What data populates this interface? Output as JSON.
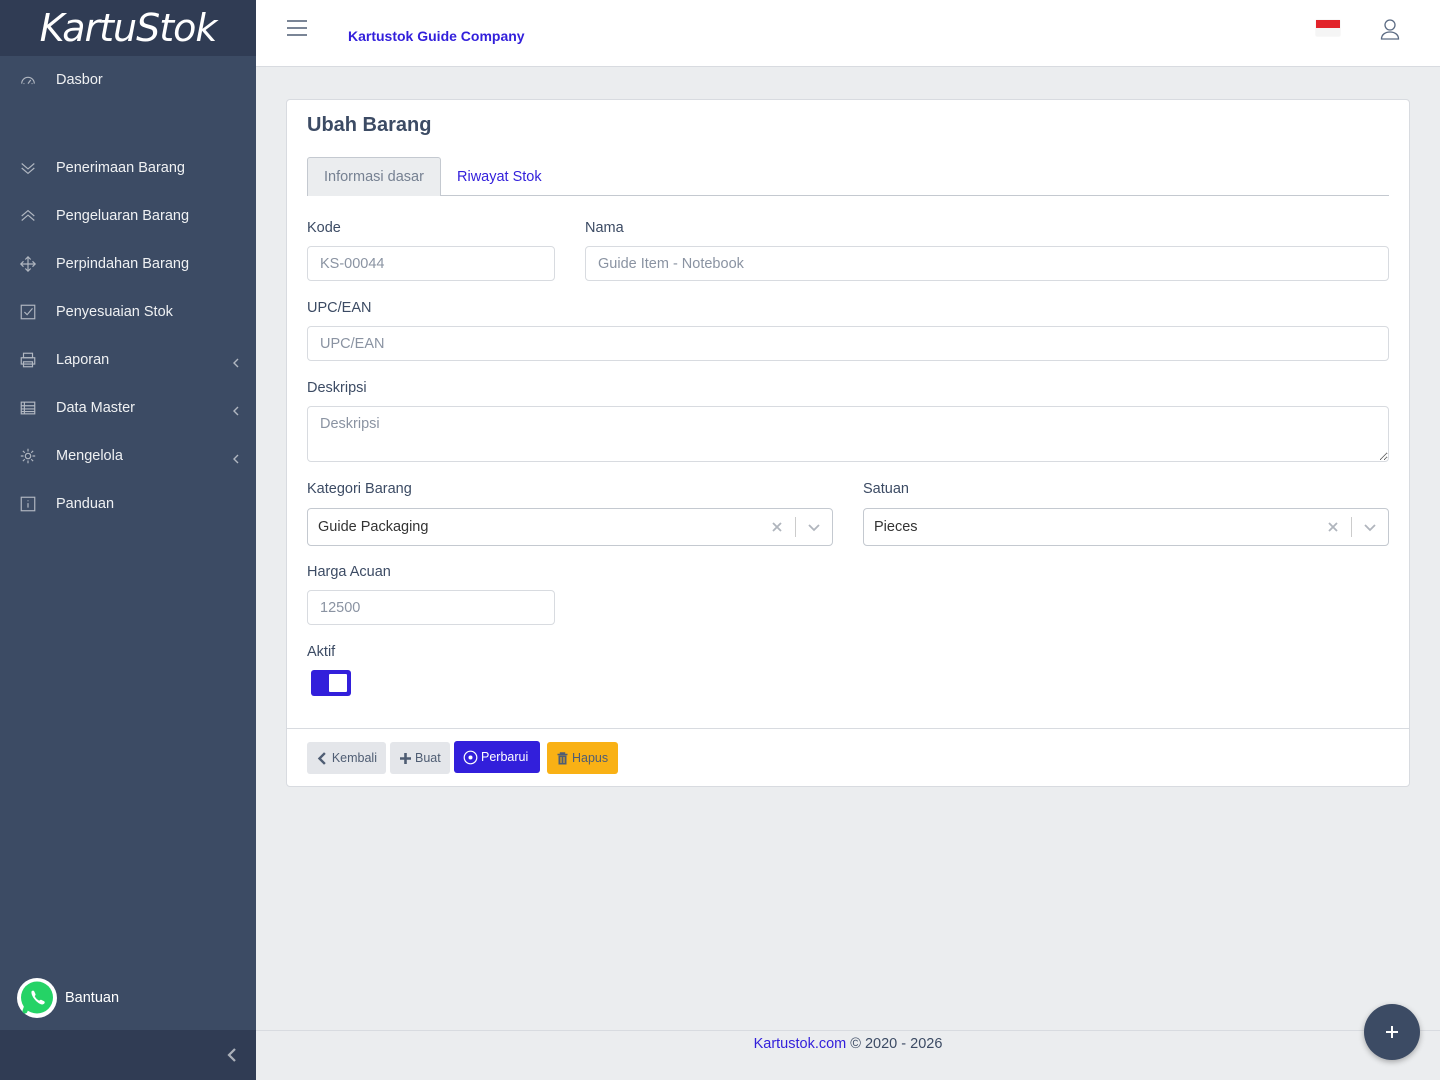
{
  "brand": {
    "name": "KartuStok"
  },
  "sidebar": {
    "items": [
      {
        "label": "Dasbor",
        "icon": "speedometer-icon"
      },
      {
        "label": "Penerimaan Barang",
        "icon": "chevron-double-down-icon"
      },
      {
        "label": "Pengeluaran Barang",
        "icon": "chevron-double-up-icon"
      },
      {
        "label": "Perpindahan Barang",
        "icon": "move-arrows-icon"
      },
      {
        "label": "Penyesuaian Stok",
        "icon": "check-square-icon"
      },
      {
        "label": "Laporan",
        "icon": "printer-icon"
      },
      {
        "label": "Data Master",
        "icon": "list-table-icon"
      },
      {
        "label": "Mengelola",
        "icon": "gear-icon"
      },
      {
        "label": "Panduan",
        "icon": "info-icon"
      }
    ],
    "help_label": "Bantuan"
  },
  "header": {
    "company": "Kartustok Guide Company"
  },
  "page": {
    "title": "Ubah Barang",
    "tabs": [
      {
        "label": "Informasi dasar"
      },
      {
        "label": "Riwayat Stok"
      }
    ]
  },
  "form": {
    "kode": {
      "label": "Kode",
      "value": "KS-00044"
    },
    "nama": {
      "label": "Nama",
      "value": "Guide Item - Notebook"
    },
    "upc": {
      "label": "UPC/EAN",
      "placeholder": "UPC/EAN"
    },
    "deskripsi": {
      "label": "Deskripsi",
      "placeholder": "Deskripsi"
    },
    "kategori": {
      "label": "Kategori Barang",
      "value": "Guide Packaging"
    },
    "satuan": {
      "label": "Satuan",
      "value": "Pieces"
    },
    "harga": {
      "label": "Harga Acuan",
      "value": "12500"
    },
    "aktif": {
      "label": "Aktif",
      "checked": true
    }
  },
  "buttons": {
    "back": "Kembali",
    "create": "Buat",
    "update": "Perbarui",
    "delete": "Hapus"
  },
  "footer": {
    "link": "Kartustok.com",
    "text": "© 2020 - 2026"
  },
  "colors": {
    "primary": "#321fdb",
    "sidebar": "#3c4b64",
    "warning": "#f9b115"
  }
}
